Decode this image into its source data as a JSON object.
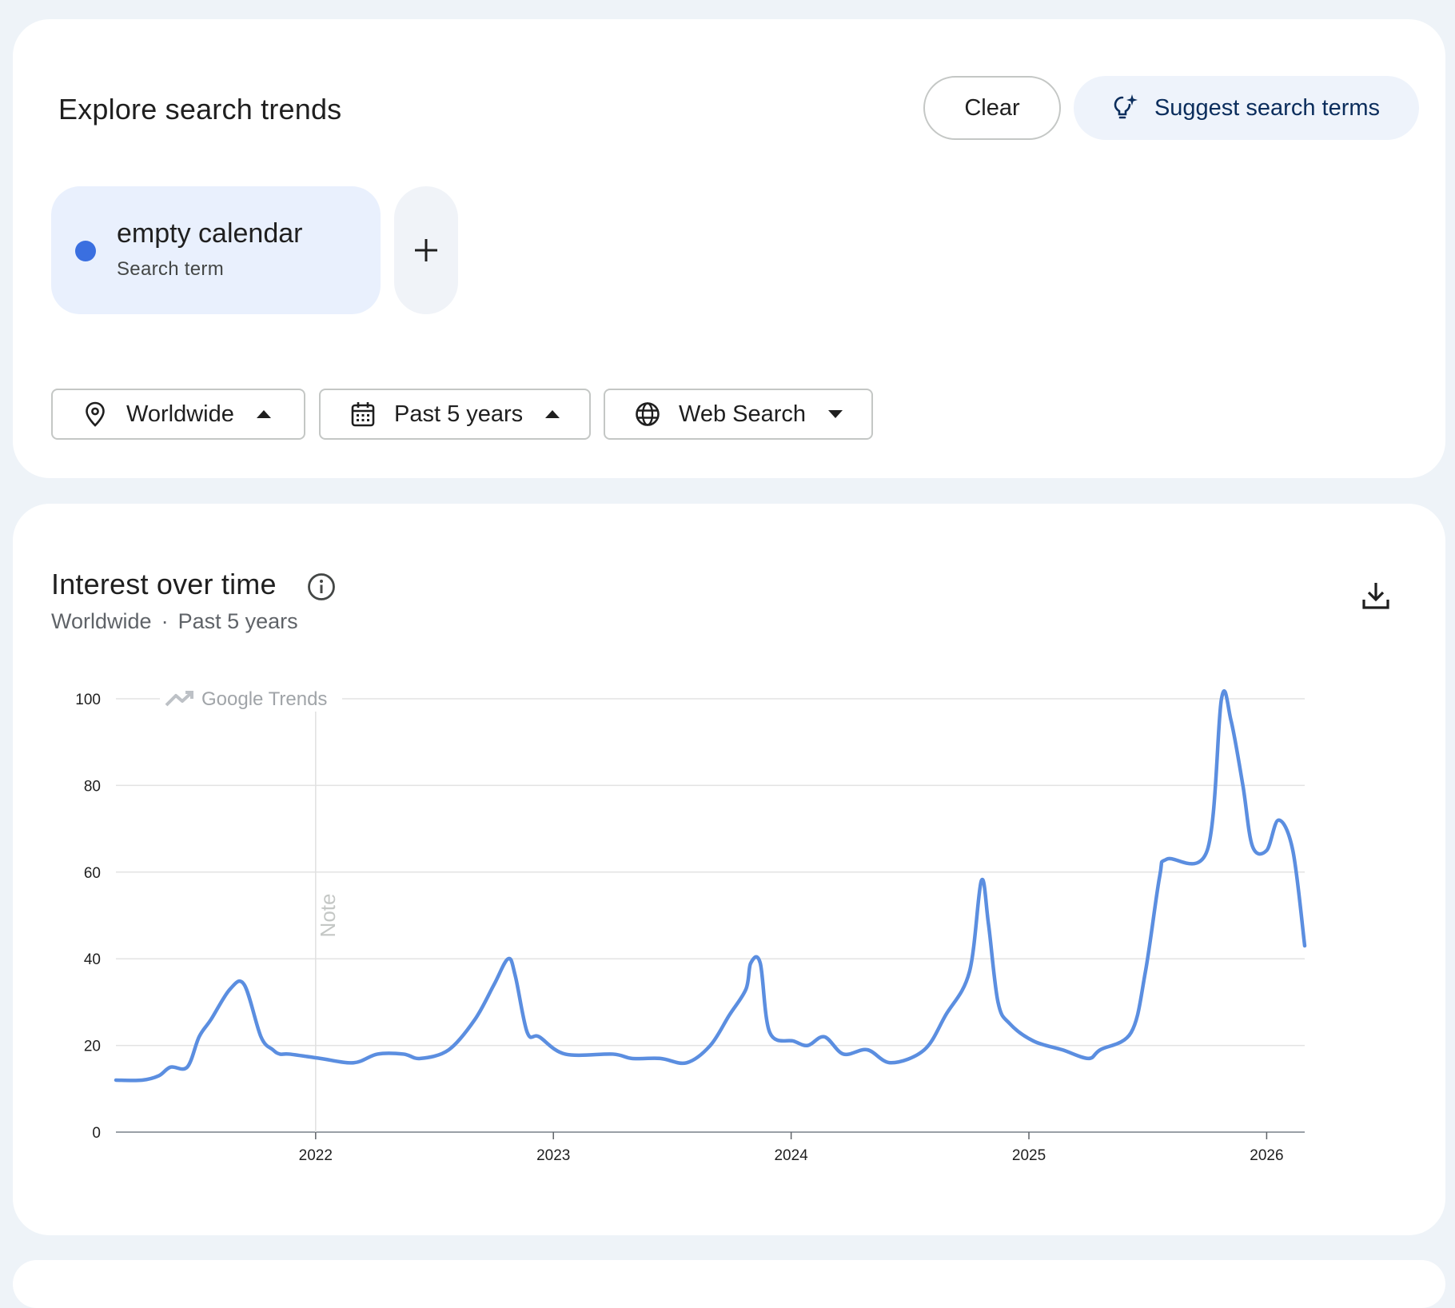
{
  "explore": {
    "title": "Explore search trends",
    "clear_label": "Clear",
    "suggest_label": "Suggest search terms"
  },
  "terms": [
    {
      "name": "empty calendar",
      "kind": "Search term",
      "color": "#3a6fe0"
    }
  ],
  "filters": {
    "location": "Worldwide",
    "time": "Past 5 years",
    "property": "Web Search"
  },
  "interest": {
    "title": "Interest over time",
    "location": "Worldwide",
    "separator": "·",
    "time": "Past 5 years"
  },
  "chart_data": {
    "type": "line",
    "watermark": "Google Trends",
    "annotation": {
      "label": "Note",
      "x": 2022.0
    },
    "y_ticks": [
      0,
      20,
      40,
      60,
      80,
      100
    ],
    "x_ticks": [
      "2022",
      "2023",
      "2024",
      "2025",
      "2026"
    ],
    "x_range": [
      2021.16,
      2026.16
    ],
    "ylim": [
      0,
      100
    ],
    "grid": true,
    "series": [
      {
        "color": "#5b8ee0",
        "x": [
          2021.16,
          2021.27,
          2021.34,
          2021.39,
          2021.46,
          2021.51,
          2021.56,
          2021.64,
          2021.7,
          2021.77,
          2021.82,
          2021.85,
          2021.89,
          2022.02,
          2022.16,
          2022.26,
          2022.37,
          2022.44,
          2022.56,
          2022.67,
          2022.75,
          2022.81,
          2022.84,
          2022.89,
          2022.94,
          2023.05,
          2023.25,
          2023.33,
          2023.45,
          2023.56,
          2023.66,
          2023.74,
          2023.81,
          2023.83,
          2023.87,
          2023.91,
          2024.01,
          2024.07,
          2024.14,
          2024.22,
          2024.32,
          2024.42,
          2024.56,
          2024.65,
          2024.75,
          2024.8,
          2024.83,
          2024.87,
          2024.92,
          2025.02,
          2025.14,
          2025.25,
          2025.3,
          2025.43,
          2025.49,
          2025.55,
          2025.58,
          2025.75,
          2025.81,
          2025.85,
          2025.9,
          2025.94,
          2026.0,
          2026.05,
          2026.11,
          2026.16
        ],
        "y": [
          12,
          12,
          13,
          15,
          15,
          22,
          26,
          33,
          34,
          22,
          19,
          18,
          18,
          17,
          16,
          18,
          18,
          17,
          19,
          26,
          34,
          40,
          36,
          23,
          22,
          18,
          18,
          17,
          17,
          16,
          20,
          27,
          33,
          39,
          39,
          23,
          21,
          20,
          22,
          18,
          19,
          16,
          19,
          27,
          37,
          58,
          48,
          30,
          25,
          21,
          19,
          17,
          19,
          23,
          37,
          59,
          63,
          65,
          100,
          95,
          80,
          66,
          65,
          72,
          65,
          43
        ]
      }
    ]
  }
}
